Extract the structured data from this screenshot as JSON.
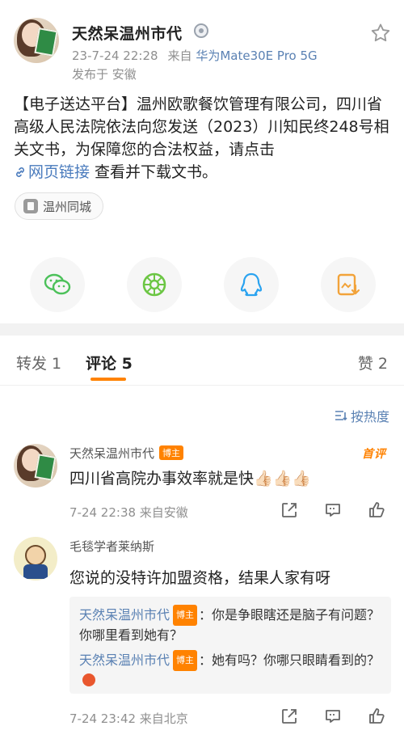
{
  "post": {
    "author": "天然呆温州市代",
    "time": "23-7-24 22:28",
    "from_prefix": "来自",
    "device": "华为Mate30E Pro 5G",
    "published": "发布于 安徽",
    "body_prefix": "【电子送达平台】温州欧歌餐饮管理有限公司，四川省高级人民法院依法向您发送（2023）川知民终248号相关文书，为保障您的合法权益，请点击",
    "body_link": "网页链接",
    "body_suffix": " 查看并下载文书。",
    "location": "温州同城",
    "share": [
      "wechat-icon",
      "moments-icon",
      "qq-icon",
      "save-image-icon"
    ]
  },
  "tabs": {
    "repost": "转发 1",
    "comment": "评论 5",
    "like": "赞 2"
  },
  "sort": {
    "label": "按热度"
  },
  "comments": [
    {
      "name": "天然呆温州市代",
      "badge": "博主",
      "first_tag": "首评",
      "text": "四川省高院办事效率就是快👍🏻👍🏻👍🏻",
      "time": "7-24 22:38  来自安徽"
    },
    {
      "name": "毛毯学者莱纳斯",
      "text": "您说的没特许加盟资格，结果人家有呀",
      "time": "7-24 23:42  来自北京",
      "replies": [
        {
          "name": "天然呆温州市代",
          "badge": "博主",
          "text": "：你是争眼瞎还是脑子有问题？你哪里看到她有？"
        },
        {
          "name": "天然呆温州市代",
          "badge": "博主",
          "text": "：她有吗？你哪只眼睛看到的？"
        }
      ]
    }
  ],
  "colors": {
    "accent": "#ff8200",
    "link": "#5a81b3"
  }
}
